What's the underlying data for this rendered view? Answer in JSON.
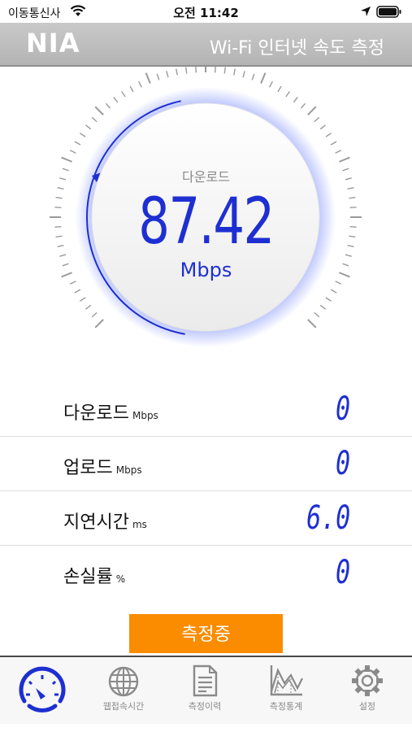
{
  "status_bar": {
    "carrier": "이동통신사",
    "time": "오전 11:42"
  },
  "header": {
    "logo": "NIA",
    "title": "Wi-Fi 인터넷 속도 측정"
  },
  "gauge": {
    "label": "다운로드",
    "value": "87.42",
    "unit": "Mbps",
    "accent": "#1e2fd2"
  },
  "results": [
    {
      "name": "다운로드",
      "unit": "Mbps",
      "value": "0"
    },
    {
      "name": "업로드",
      "unit": "Mbps",
      "value": "0"
    },
    {
      "name": "지연시간",
      "unit": "ms",
      "value": "6.0"
    },
    {
      "name": "손실률",
      "unit": "%",
      "value": "0"
    }
  ],
  "measure_button": {
    "label": "측정중",
    "color": "#fb8c00"
  },
  "tabs": [
    {
      "icon": "speedometer-icon",
      "label": ""
    },
    {
      "icon": "globe-icon",
      "label": "웹접속시간"
    },
    {
      "icon": "document-icon",
      "label": "측정이력"
    },
    {
      "icon": "chart-icon",
      "label": "측정통계"
    },
    {
      "icon": "gear-icon",
      "label": "설정"
    }
  ]
}
